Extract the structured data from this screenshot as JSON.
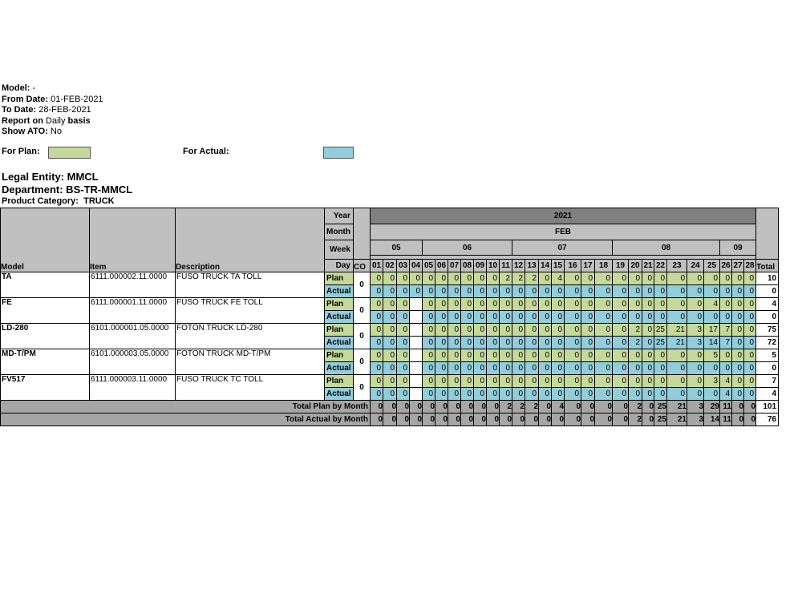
{
  "params": {
    "model_label": "Model:",
    "model_value": "-",
    "from_label": "From Date:",
    "from_value": "01-FEB-2021",
    "to_label": "To Date:",
    "to_value": "28-FEB-2021",
    "report_label": "Report on",
    "report_value_1": "Daily",
    "report_value_2": "basis",
    "ato_label": "Show ATO:",
    "ato_value": "No"
  },
  "legend": {
    "plan_label": "For Plan:",
    "actual_label": "For Actual:",
    "plan_color": "#c5d99a",
    "actual_color": "#92cddc"
  },
  "entity": {
    "legal": "Legal Entity: MMCL",
    "dept": "Department: BS-TR-MMCL",
    "category_label": "Product Category:",
    "category_value": "TRUCK"
  },
  "header": {
    "year_label": "Year",
    "month_label": "Month",
    "week_label": "Week",
    "day_label": "Day",
    "year": "2021",
    "month": "FEB",
    "weeks": [
      {
        "label": "05",
        "span": 4
      },
      {
        "label": "06",
        "span": 7
      },
      {
        "label": "07",
        "span": 7
      },
      {
        "label": "08",
        "span": 7
      },
      {
        "label": "09",
        "span": 3
      }
    ],
    "days": [
      "01",
      "02",
      "03",
      "04",
      "05",
      "06",
      "07",
      "08",
      "09",
      "10",
      "11",
      "12",
      "13",
      "14",
      "15",
      "16",
      "17",
      "18",
      "19",
      "20",
      "21",
      "22",
      "23",
      "24",
      "25",
      "26",
      "27",
      "28"
    ],
    "col_model": "Model",
    "col_item": "Item",
    "col_desc": "Description",
    "col_co": "CO",
    "col_total": "Total",
    "plan_label": "Plan",
    "actual_label": "Actual"
  },
  "rows": [
    {
      "model": "TA",
      "item": "6111.000002.11.0000",
      "desc": "FUSO TRUCK TA TOLL",
      "co": "0",
      "plan": [
        "0",
        "0",
        "0",
        "0",
        "0",
        "0",
        "0",
        "0",
        "0",
        "0",
        "2",
        "2",
        "2",
        "0",
        "4",
        "0",
        "0",
        "0",
        "0",
        "0",
        "0",
        "0",
        "0",
        "0",
        "0",
        "0",
        "0",
        "0"
      ],
      "plan_total": "10",
      "actual": [
        "0",
        "0",
        "0",
        "0",
        "0",
        "0",
        "0",
        "0",
        "0",
        "0",
        "0",
        "0",
        "0",
        "0",
        "0",
        "0",
        "0",
        "0",
        "0",
        "0",
        "0",
        "0",
        "0",
        "0",
        "0",
        "0",
        "0",
        "0"
      ],
      "actual_total": "0"
    },
    {
      "model": "FE",
      "item": "6111.000001.11.0000",
      "desc": "FUSO TRUCK FE TOLL",
      "co": "0",
      "plan": [
        "0",
        "0",
        "0",
        "",
        "0",
        "0",
        "0",
        "0",
        "0",
        "0",
        "0",
        "0",
        "0",
        "0",
        "0",
        "0",
        "0",
        "0",
        "0",
        "0",
        "0",
        "0",
        "0",
        "0",
        "4",
        "0",
        "0",
        "0"
      ],
      "plan_total": "4",
      "actual": [
        "0",
        "0",
        "0",
        "",
        "0",
        "0",
        "0",
        "0",
        "0",
        "0",
        "0",
        "0",
        "0",
        "0",
        "0",
        "0",
        "0",
        "0",
        "0",
        "0",
        "0",
        "0",
        "0",
        "0",
        "0",
        "0",
        "0",
        "0"
      ],
      "actual_total": "0"
    },
    {
      "model": "LD-280",
      "item": "6101.000001.05.0000",
      "desc": "FOTON TRUCK LD-280",
      "co": "0",
      "plan": [
        "0",
        "0",
        "0",
        "",
        "0",
        "0",
        "0",
        "0",
        "0",
        "0",
        "0",
        "0",
        "0",
        "0",
        "0",
        "0",
        "0",
        "0",
        "0",
        "2",
        "0",
        "25",
        "21",
        "3",
        "17",
        "7",
        "0",
        "0"
      ],
      "plan_total": "75",
      "actual": [
        "0",
        "0",
        "0",
        "",
        "0",
        "0",
        "0",
        "0",
        "0",
        "0",
        "0",
        "0",
        "0",
        "0",
        "0",
        "0",
        "0",
        "0",
        "0",
        "2",
        "0",
        "25",
        "21",
        "3",
        "14",
        "7",
        "0",
        "0"
      ],
      "actual_total": "72"
    },
    {
      "model": "MD-T/PM",
      "item": "6101.000003.05.0000",
      "desc": "FOTON TRUCK MD-T/PM",
      "co": "0",
      "plan": [
        "0",
        "0",
        "0",
        "",
        "0",
        "0",
        "0",
        "0",
        "0",
        "0",
        "0",
        "0",
        "0",
        "0",
        "0",
        "0",
        "0",
        "0",
        "0",
        "0",
        "0",
        "0",
        "0",
        "0",
        "5",
        "0",
        "0",
        "0"
      ],
      "plan_total": "5",
      "actual": [
        "0",
        "0",
        "0",
        "",
        "0",
        "0",
        "0",
        "0",
        "0",
        "0",
        "0",
        "0",
        "0",
        "0",
        "0",
        "0",
        "0",
        "0",
        "0",
        "0",
        "0",
        "0",
        "0",
        "0",
        "0",
        "0",
        "0",
        "0"
      ],
      "actual_total": "0"
    },
    {
      "model": "FV517",
      "item": "6111.000003.11.0000",
      "desc": "FUSO TRUCK TC TOLL",
      "co": "0",
      "plan": [
        "0",
        "0",
        "0",
        "",
        "0",
        "0",
        "0",
        "0",
        "0",
        "0",
        "0",
        "0",
        "0",
        "0",
        "0",
        "0",
        "0",
        "0",
        "0",
        "0",
        "0",
        "0",
        "0",
        "0",
        "3",
        "4",
        "0",
        "0"
      ],
      "plan_total": "7",
      "actual": [
        "0",
        "0",
        "0",
        "",
        "0",
        "0",
        "0",
        "0",
        "0",
        "0",
        "0",
        "0",
        "0",
        "0",
        "0",
        "0",
        "0",
        "0",
        "0",
        "0",
        "0",
        "0",
        "0",
        "0",
        "0",
        "4",
        "0",
        "0"
      ],
      "actual_total": "4"
    }
  ],
  "totals": {
    "plan_label": "Total Plan by Month",
    "plan": [
      "0",
      "0",
      "0",
      "0",
      "0",
      "0",
      "0",
      "0",
      "0",
      "0",
      "2",
      "2",
      "2",
      "0",
      "4",
      "0",
      "0",
      "0",
      "0",
      "2",
      "0",
      "25",
      "21",
      "3",
      "29",
      "11",
      "0",
      "0"
    ],
    "plan_total": "101",
    "actual_label": "Total Actual by Month",
    "actual": [
      "0",
      "0",
      "0",
      "0",
      "0",
      "0",
      "0",
      "0",
      "0",
      "0",
      "0",
      "0",
      "0",
      "0",
      "0",
      "0",
      "0",
      "0",
      "0",
      "2",
      "0",
      "25",
      "21",
      "3",
      "14",
      "11",
      "0",
      "0"
    ],
    "actual_total": "76"
  }
}
